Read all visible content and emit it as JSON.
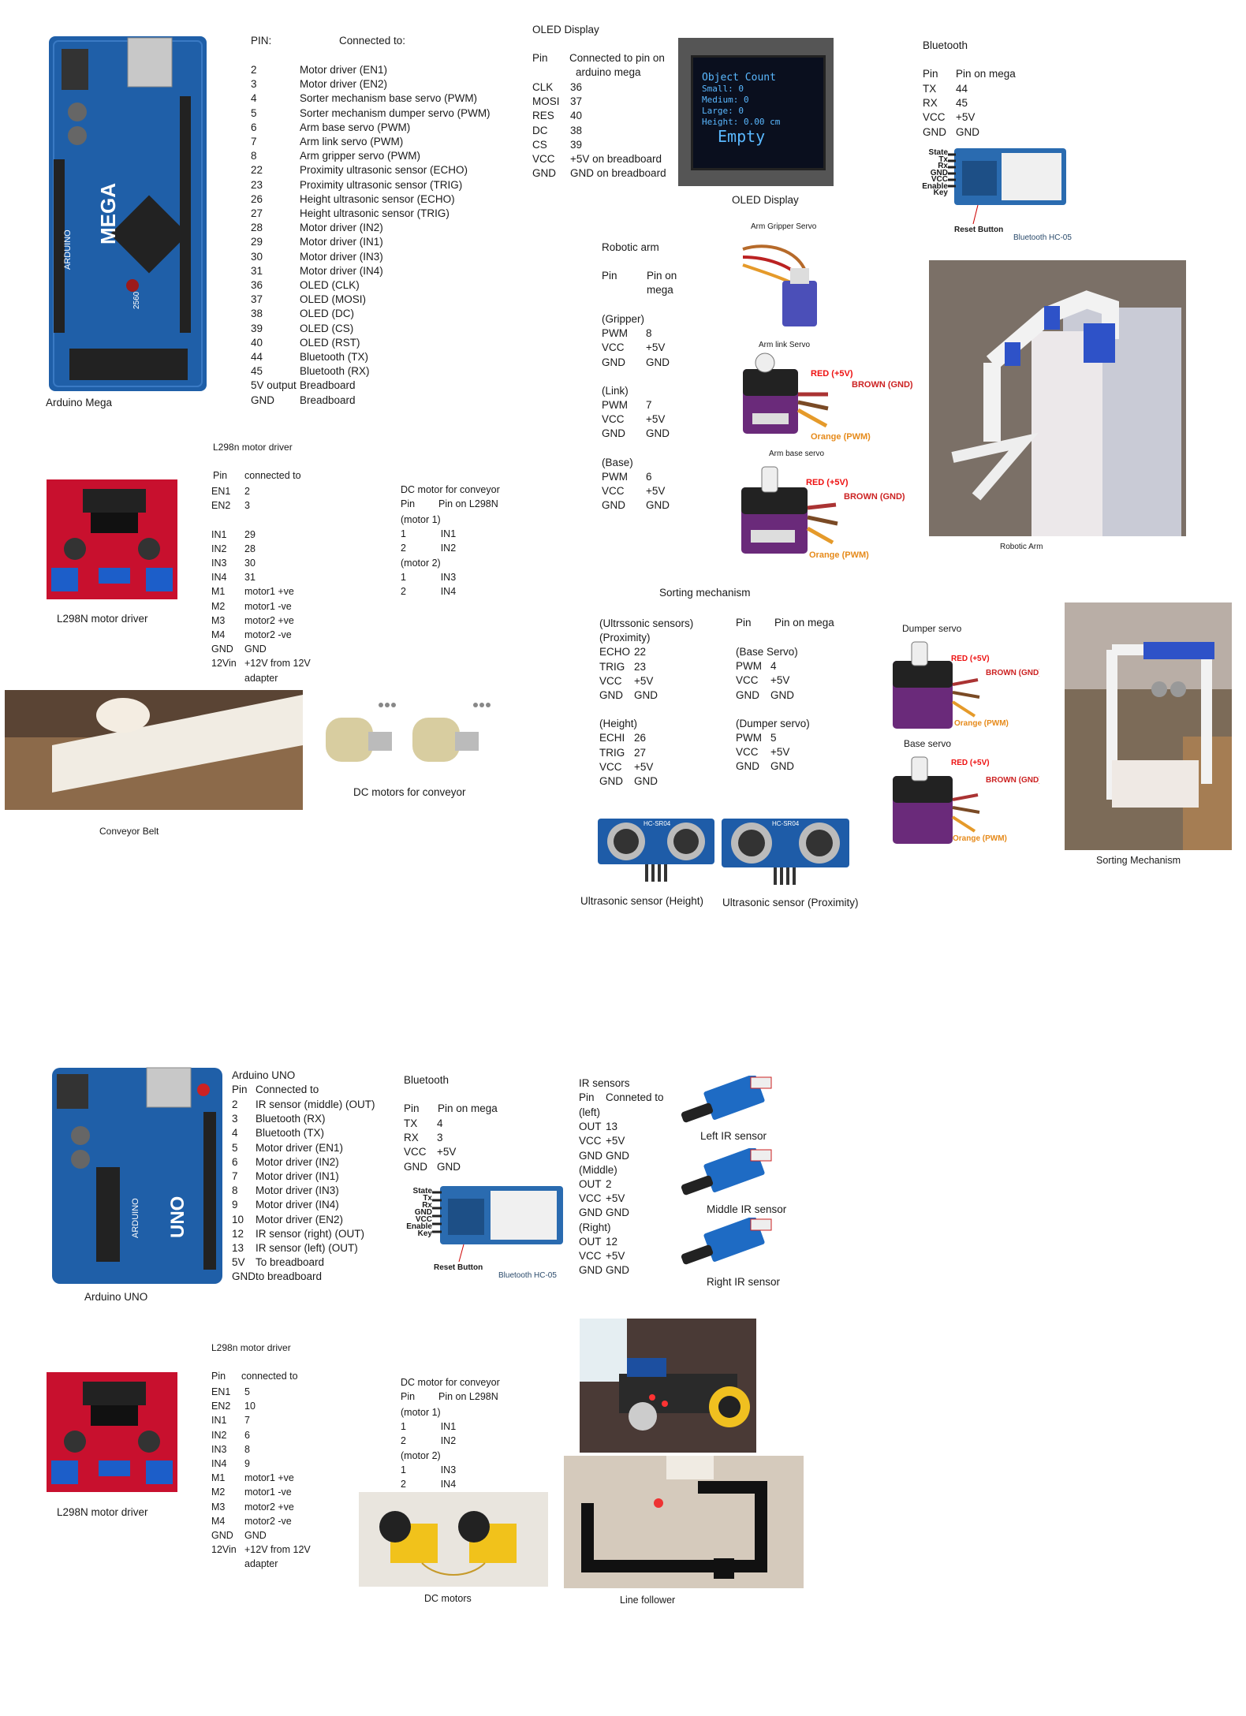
{
  "mega_section": {
    "board_caption": "Arduino Mega",
    "header_pin": "PIN:",
    "header_conn": "Connected to:",
    "rows": [
      [
        "2",
        "Motor driver (EN1)"
      ],
      [
        "3",
        "Motor driver (EN2)"
      ],
      [
        "4",
        "Sorter mechanism base servo  (PWM)"
      ],
      [
        "5",
        "Sorter mechanism dumper servo (PWM)"
      ],
      [
        "6",
        "Arm base servo (PWM)"
      ],
      [
        "7",
        "Arm link servo  (PWM)"
      ],
      [
        "8",
        "Arm gripper servo (PWM)"
      ],
      [
        "22",
        "Proximity ultrasonic sensor (ECHO)"
      ],
      [
        "23",
        "Proximity ultrasonic sensor (TRIG)"
      ],
      [
        "26",
        "Height ultrasonic sensor (ECHO)"
      ],
      [
        "27",
        "Height ultrasonic sensor (TRIG)"
      ],
      [
        "28",
        "Motor driver (IN2)"
      ],
      [
        "29",
        "Motor driver (IN1)"
      ],
      [
        "30",
        "Motor driver (IN3)"
      ],
      [
        "31",
        "Motor driver (IN4)"
      ],
      [
        "36",
        "OLED (CLK)"
      ],
      [
        "37",
        "OLED (MOSI)"
      ],
      [
        "38",
        "OLED (DC)"
      ],
      [
        "39",
        "OLED (CS)"
      ],
      [
        "40",
        "OLED (RST)"
      ],
      [
        "44",
        "Bluetooth (TX)"
      ],
      [
        "45",
        "Bluetooth (RX)"
      ],
      [
        "5V output",
        "Breadboard"
      ],
      [
        "GND",
        "Breadboard"
      ]
    ],
    "board_text": {
      "brand": "MEGA",
      "sub": "ARDUINO",
      "model": "2560"
    }
  },
  "oled_section": {
    "title": "OLED Display",
    "header_pin": "Pin",
    "header_conn": "Connected to pin on",
    "header_conn2": "arduino mega",
    "rows": [
      [
        "CLK",
        "36"
      ],
      [
        "MOSI",
        "37"
      ],
      [
        "RES",
        "40"
      ],
      [
        "DC",
        "38"
      ],
      [
        "CS",
        "39"
      ],
      [
        "VCC",
        "+5V on breadboard"
      ],
      [
        "GND",
        "GND on breadboard"
      ]
    ],
    "caption": "OLED Display",
    "screen": {
      "header": "Object Count",
      "l1": "Small: 0",
      "l2": "Medium: 0",
      "l3": "Large: 0",
      "l4": "Height: 0.00 cm",
      "status": "Empty"
    }
  },
  "bt1_section": {
    "title": "Bluetooth",
    "header_pin": "Pin",
    "header_conn": "Pin on mega",
    "rows": [
      [
        "TX",
        "44"
      ],
      [
        "RX",
        "45"
      ],
      [
        "VCC",
        "+5V"
      ],
      [
        "GND",
        "GND"
      ]
    ],
    "module_caption": "Bluetooth HC-05",
    "reset_label": "Reset Button",
    "pins": [
      "State",
      "Tx",
      "Rx",
      "GND",
      "VCC",
      "Enable",
      "Key"
    ]
  },
  "arm_section": {
    "title": "Robotic arm",
    "header_pin": "Pin",
    "header_conn": "Pin on",
    "header_conn2": "mega",
    "groups": [
      {
        "name": "(Gripper)",
        "rows": [
          [
            "PWM",
            "8"
          ],
          [
            "VCC",
            "+5V"
          ],
          [
            "GND",
            "GND"
          ]
        ]
      },
      {
        "name": "(Link)",
        "rows": [
          [
            "PWM",
            "7"
          ],
          [
            "VCC",
            "+5V"
          ],
          [
            "GND",
            "GND"
          ]
        ]
      },
      {
        "name": "(Base)",
        "rows": [
          [
            "PWM",
            "6"
          ],
          [
            "VCC",
            "+5V"
          ],
          [
            "GND",
            "GND"
          ]
        ]
      }
    ],
    "gripper_caption": "Arm Gripper Servo",
    "link_caption": "Arm link Servo",
    "base_caption": "Arm base servo",
    "photo_caption": "Robotic Arm",
    "wire_red": "RED (+5V)",
    "wire_brown": "BROWN (GND)",
    "wire_orange": "Orange (PWM)"
  },
  "l298_1": {
    "title": "L298n motor driver",
    "header_pin": "Pin",
    "header_conn": "connected to",
    "rows": [
      [
        "EN1",
        "2"
      ],
      [
        "EN2",
        "3"
      ],
      [
        "",
        ""
      ],
      [
        "IN1",
        "29"
      ],
      [
        "IN2",
        "28"
      ],
      [
        "IN3",
        "30"
      ],
      [
        "IN4",
        "31"
      ],
      [
        "M1",
        "motor1 +ve"
      ],
      [
        "M2",
        "motor1 -ve"
      ],
      [
        "M3",
        "motor2 +ve"
      ],
      [
        "M4",
        "motor2  -ve"
      ],
      [
        "GND",
        "GND"
      ],
      [
        "12Vin",
        "+12V from 12V"
      ],
      [
        "",
        "adapter"
      ]
    ],
    "caption": "L298N motor driver"
  },
  "dc1": {
    "title": "DC motor for conveyor",
    "header_pin": "Pin",
    "header_conn": "Pin on L298N",
    "rows": [
      [
        "(motor 1)",
        ""
      ],
      [
        "1",
        "IN1"
      ],
      [
        "2",
        "IN2"
      ],
      [
        "(motor 2)",
        ""
      ],
      [
        "1",
        "IN3"
      ],
      [
        "2",
        "IN4"
      ]
    ],
    "motors_caption": "DC motors for conveyor",
    "belt_caption": "Conveyor Belt"
  },
  "sorting": {
    "title": "Sorting mechanism",
    "left_groups": [
      {
        "name": "(Ultrssonic sensors)",
        "rows": [
          [
            "(Proximity)",
            ""
          ],
          [
            "ECHO",
            "22"
          ],
          [
            "TRIG",
            "23"
          ],
          [
            "VCC",
            "+5V"
          ],
          [
            "GND",
            "GND"
          ]
        ]
      },
      {
        "name": "(Height)",
        "rows": [
          [
            "ECHI",
            "26"
          ],
          [
            "TRIG",
            "27"
          ],
          [
            "VCC",
            "+5V"
          ],
          [
            "GND",
            "GND"
          ]
        ]
      }
    ],
    "right_header_pin": "Pin",
    "right_header_conn": "Pin on mega",
    "right_groups": [
      {
        "name": "(Base Servo)",
        "rows": [
          [
            "PWM",
            "4"
          ],
          [
            "VCC",
            "+5V"
          ],
          [
            "GND",
            "GND"
          ]
        ]
      },
      {
        "name": "(Dumper servo)",
        "rows": [
          [
            "PWM",
            "5"
          ],
          [
            "VCC",
            "+5V"
          ],
          [
            "GND",
            "GND"
          ]
        ]
      }
    ],
    "us_height_caption": "Ultrasonic sensor (Height)",
    "us_prox_caption": "Ultrasonic sensor (Proximity)",
    "dumper_caption": "Dumper servo",
    "base_caption": "Base servo",
    "photo_caption": "Sorting Mechanism",
    "wire_red": "RED (+5V)",
    "wire_brown": "BROWN (GND)",
    "wire_orange": "Orange (PWM)",
    "us_model": "HC-SR04"
  },
  "uno_section": {
    "title": "Arduino UNO",
    "header_pin": "Pin",
    "header_conn": "Connected to",
    "rows": [
      [
        "2",
        "IR sensor (middle)  (OUT)"
      ],
      [
        "3",
        "Bluetooth (RX)"
      ],
      [
        "4",
        "Bluetooth (TX)"
      ],
      [
        "5",
        "Motor driver (EN1)"
      ],
      [
        "6",
        "Motor driver (IN2)"
      ],
      [
        "7",
        "Motor driver (IN1)"
      ],
      [
        "8",
        "Motor driver (IN3)"
      ],
      [
        "9",
        "Motor driver (IN4)"
      ],
      [
        "10",
        "Motor driver (EN2)"
      ],
      [
        "12",
        "IR sensor (right) (OUT)"
      ],
      [
        "13",
        "IR sensor (left) (OUT)"
      ],
      [
        "5V",
        "To breadboard"
      ],
      [
        "GND",
        "to breadboard"
      ]
    ],
    "caption": "Arduino UNO",
    "board_text": {
      "brand": "UNO",
      "sub": "ARDUINO"
    }
  },
  "bt2_section": {
    "title": "Bluetooth",
    "header_pin": "Pin",
    "header_conn": "Pin on mega",
    "rows": [
      [
        "TX",
        "4"
      ],
      [
        "RX",
        "3"
      ],
      [
        "VCC",
        "+5V"
      ],
      [
        "GND",
        "GND"
      ]
    ],
    "module_caption": "Bluetooth HC-05",
    "reset_label": "Reset Button",
    "pins": [
      "State",
      "Tx",
      "Rx",
      "GND",
      "VCC",
      "Enable",
      "Key"
    ]
  },
  "ir_section": {
    "title": "IR sensors",
    "header_pin": "Pin",
    "header_conn": "Conneted to",
    "groups": [
      {
        "name": "(left)",
        "rows": [
          [
            "OUT",
            "13"
          ],
          [
            "VCC",
            "+5V"
          ],
          [
            "GND",
            "GND"
          ]
        ]
      },
      {
        "name": "(Middle)",
        "rows": [
          [
            "OUT",
            "2"
          ],
          [
            "VCC",
            "+5V"
          ],
          [
            "GND",
            "GND"
          ]
        ]
      },
      {
        "name": "(Right)",
        "rows": [
          [
            "OUT",
            "12"
          ],
          [
            "VCC",
            "+5V"
          ],
          [
            "GND",
            "GND"
          ]
        ]
      }
    ],
    "left_caption": "Left IR sensor",
    "middle_caption": "Middle IR sensor",
    "right_caption": "Right IR sensor"
  },
  "l298_2": {
    "title": "L298n motor driver",
    "header_pin": "Pin",
    "header_conn": "connected to",
    "rows": [
      [
        "EN1",
        "5"
      ],
      [
        "EN2",
        "10"
      ],
      [
        "IN1",
        "7"
      ],
      [
        "IN2",
        "6"
      ],
      [
        "IN3",
        "8"
      ],
      [
        "IN4",
        "9"
      ],
      [
        "M1",
        "motor1 +ve"
      ],
      [
        "M2",
        "motor1 -ve"
      ],
      [
        "M3",
        "motor2 +ve"
      ],
      [
        "M4",
        "motor2  -ve"
      ],
      [
        "GND",
        "GND"
      ],
      [
        "12Vin",
        "+12V from 12V"
      ],
      [
        "",
        "adapter"
      ]
    ],
    "caption": "L298N motor driver"
  },
  "dc2": {
    "title": "DC motor for conveyor",
    "header_pin": "Pin",
    "header_conn": "Pin on L298N",
    "rows": [
      [
        "(motor 1)",
        ""
      ],
      [
        "1",
        "IN1"
      ],
      [
        "2",
        "IN2"
      ],
      [
        "(motor 2)",
        ""
      ],
      [
        "1",
        "IN3"
      ],
      [
        "2",
        "IN4"
      ]
    ],
    "motors_caption": "DC motors",
    "follower_caption": "Line follower"
  }
}
